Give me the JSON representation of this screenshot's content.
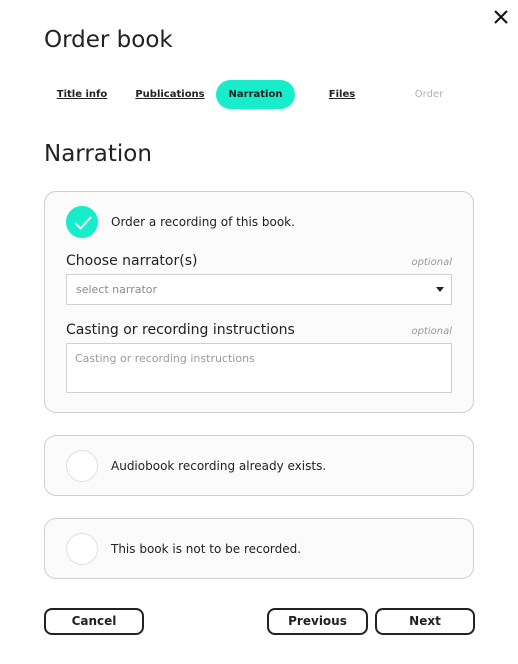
{
  "dialog": {
    "title": "Order book",
    "close_icon": "close-icon"
  },
  "tabs": [
    {
      "label": "Title info",
      "state": "visited"
    },
    {
      "label": "Publications",
      "state": "visited"
    },
    {
      "label": "Narration",
      "state": "active"
    },
    {
      "label": "Files",
      "state": "visited"
    },
    {
      "label": "Order",
      "state": "disabled"
    }
  ],
  "section": {
    "title": "Narration"
  },
  "options": {
    "order_recording": {
      "label": "Order a recording of this book.",
      "selected": true,
      "narrator": {
        "label": "Choose narrator(s)",
        "optional": "optional",
        "placeholder": "select narrator"
      },
      "instructions": {
        "label": "Casting or recording instructions",
        "optional": "optional",
        "placeholder": "Casting or recording instructions"
      }
    },
    "already_exists": {
      "label": "Audiobook recording already exists.",
      "selected": false
    },
    "not_recorded": {
      "label": "This book is not to be recorded.",
      "selected": false
    }
  },
  "buttons": {
    "cancel": "Cancel",
    "previous": "Previous",
    "next": "Next"
  },
  "colors": {
    "accent": "#17eccb",
    "text": "#222222",
    "border": "#cfcfcf"
  }
}
